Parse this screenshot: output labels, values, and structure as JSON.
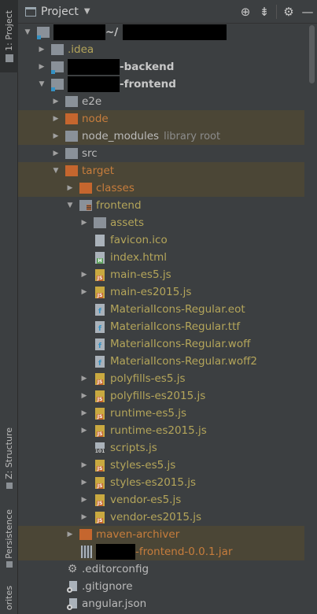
{
  "sidebar": {
    "tabs": [
      {
        "label": "1: Project"
      },
      {
        "label": "Z: Structure"
      },
      {
        "label": "Persistence"
      },
      {
        "label": "orites"
      }
    ]
  },
  "header": {
    "title": "Project",
    "icons": [
      "crosshair-icon",
      "collapse-icon",
      "gear-icon",
      "minimize-icon"
    ]
  },
  "tree": [
    {
      "depth": 0,
      "arrow": "open",
      "icon": "module-folder",
      "name": "~/",
      "redact_before": 66,
      "redact_after": 132,
      "style": "bold"
    },
    {
      "depth": 1,
      "arrow": "closed",
      "icon": "folder",
      "name": ".idea",
      "style": "olive"
    },
    {
      "depth": 1,
      "arrow": "closed",
      "icon": "module-folder",
      "name": "-backend",
      "redact_before": 66,
      "style": "bold"
    },
    {
      "depth": 1,
      "arrow": "open",
      "icon": "module-folder",
      "name": "-frontend",
      "redact_before": 66,
      "style": "bold"
    },
    {
      "depth": 2,
      "arrow": "closed",
      "icon": "folder",
      "name": "e2e",
      "style": "normal"
    },
    {
      "depth": 2,
      "arrow": "closed",
      "icon": "folder-orange",
      "name": "node",
      "style": "brown",
      "highlight": true
    },
    {
      "depth": 2,
      "arrow": "closed",
      "icon": "folder",
      "name": "node_modules",
      "hint": "library root",
      "style": "normal",
      "highlight": true
    },
    {
      "depth": 2,
      "arrow": "closed",
      "icon": "folder",
      "name": "src",
      "style": "normal"
    },
    {
      "depth": 2,
      "arrow": "open",
      "icon": "folder-orange",
      "name": "target",
      "style": "brown",
      "highlight": true
    },
    {
      "depth": 3,
      "arrow": "closed",
      "icon": "folder-orange",
      "name": "classes",
      "style": "brown",
      "highlight": true
    },
    {
      "depth": 3,
      "arrow": "open",
      "icon": "folder-lines",
      "name": "frontend",
      "style": "olive"
    },
    {
      "depth": 4,
      "arrow": "closed",
      "icon": "folder",
      "name": "assets",
      "style": "olive"
    },
    {
      "depth": 4,
      "arrow": "none",
      "icon": "file",
      "name": "favicon.ico",
      "style": "olive"
    },
    {
      "depth": 4,
      "arrow": "none",
      "icon": "file-html",
      "name": "index.html",
      "style": "olive"
    },
    {
      "depth": 4,
      "arrow": "closed",
      "icon": "file-js",
      "name": "main-es5.js",
      "style": "olive"
    },
    {
      "depth": 4,
      "arrow": "closed",
      "icon": "file-js",
      "name": "main-es2015.js",
      "style": "olive"
    },
    {
      "depth": 4,
      "arrow": "none",
      "icon": "file-font",
      "name": "MaterialIcons-Regular.eot",
      "style": "olive"
    },
    {
      "depth": 4,
      "arrow": "none",
      "icon": "file-font",
      "name": "MaterialIcons-Regular.ttf",
      "style": "olive"
    },
    {
      "depth": 4,
      "arrow": "none",
      "icon": "file-font",
      "name": "MaterialIcons-Regular.woff",
      "style": "olive"
    },
    {
      "depth": 4,
      "arrow": "none",
      "icon": "file-font",
      "name": "MaterialIcons-Regular.woff2",
      "style": "olive"
    },
    {
      "depth": 4,
      "arrow": "closed",
      "icon": "file-js",
      "name": "polyfills-es5.js",
      "style": "olive"
    },
    {
      "depth": 4,
      "arrow": "closed",
      "icon": "file-js",
      "name": "polyfills-es2015.js",
      "style": "olive"
    },
    {
      "depth": 4,
      "arrow": "closed",
      "icon": "file-js",
      "name": "runtime-es5.js",
      "style": "olive"
    },
    {
      "depth": 4,
      "arrow": "closed",
      "icon": "file-js",
      "name": "runtime-es2015.js",
      "style": "olive"
    },
    {
      "depth": 4,
      "arrow": "none",
      "icon": "file-num",
      "name": "scripts.js",
      "style": "olive"
    },
    {
      "depth": 4,
      "arrow": "closed",
      "icon": "file-js",
      "name": "styles-es5.js",
      "style": "olive"
    },
    {
      "depth": 4,
      "arrow": "closed",
      "icon": "file-js",
      "name": "styles-es2015.js",
      "style": "olive"
    },
    {
      "depth": 4,
      "arrow": "closed",
      "icon": "file-js",
      "name": "vendor-es5.js",
      "style": "olive"
    },
    {
      "depth": 4,
      "arrow": "closed",
      "icon": "file-js",
      "name": "vendor-es2015.js",
      "style": "olive"
    },
    {
      "depth": 3,
      "arrow": "closed",
      "icon": "folder-orange",
      "name": "maven-archiver",
      "style": "brown",
      "highlight": true
    },
    {
      "depth": 3,
      "arrow": "none",
      "icon": "jar",
      "name": "-frontend-0.0.1.jar",
      "redact_before": 50,
      "style": "brown",
      "highlight": true
    },
    {
      "depth": 2,
      "arrow": "none",
      "icon": "gear",
      "name": ".editorconfig",
      "style": "normal"
    },
    {
      "depth": 2,
      "arrow": "none",
      "icon": "file-git",
      "name": ".gitignore",
      "style": "normal"
    },
    {
      "depth": 2,
      "arrow": "none",
      "icon": "file-git",
      "name": "angular.json",
      "style": "normal"
    }
  ],
  "theme": {
    "background": "#3c3f41",
    "highlight": "#4b4636",
    "olive_text": "#b4a55a",
    "excluded_text": "#c77d3c",
    "folder_orange": "#c5662e"
  }
}
